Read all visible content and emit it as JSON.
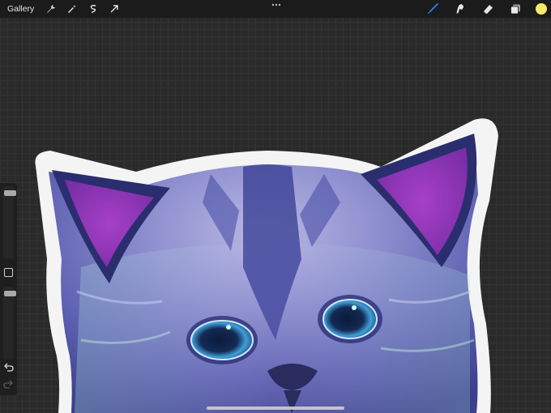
{
  "toolbar": {
    "gallery_label": "Gallery",
    "left_icons": [
      "wrench-icon",
      "magic-wand-icon",
      "selection-icon",
      "transform-arrow-icon"
    ],
    "right_icons": [
      "brush-icon",
      "smudge-icon",
      "eraser-icon",
      "layers-icon"
    ],
    "active_tool": "brush",
    "active_color": "#f7e96a",
    "accent_color": "#2f7cf6"
  },
  "sidebar": {
    "brush_size_level": 0.06,
    "opacity_level": 0.06,
    "items": [
      "brush-size-slider",
      "modify-button",
      "opacity-slider",
      "undo-button",
      "redo-button"
    ]
  },
  "canvas": {
    "subject": "cat-portrait"
  }
}
